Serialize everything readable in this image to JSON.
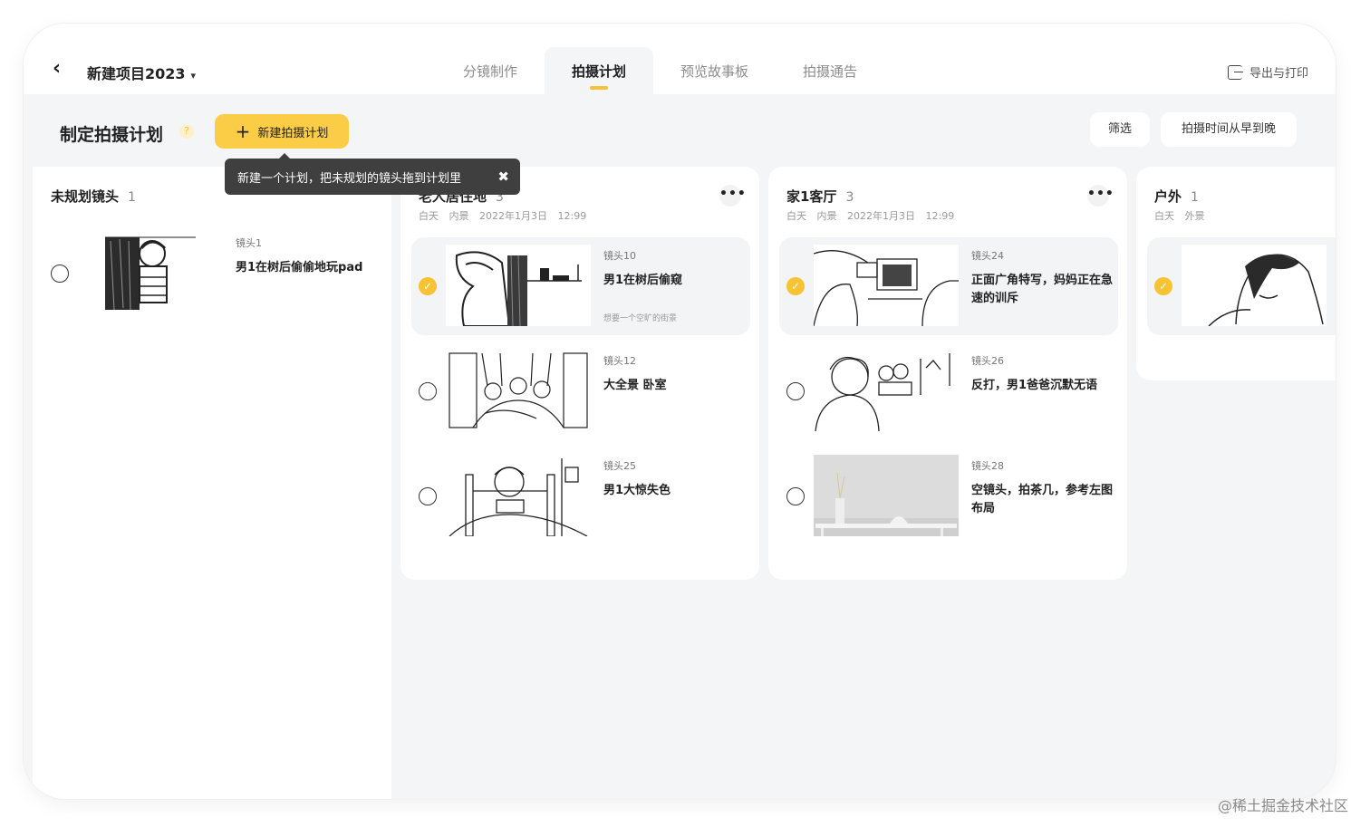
{
  "header": {
    "project_title": "新建项目2023",
    "tabs": [
      "分镜制作",
      "拍摄计划",
      "预览故事板",
      "拍摄通告"
    ],
    "active_tab": "拍摄计划",
    "export_label": "导出与打印"
  },
  "toolbar": {
    "title": "制定拍摄计划",
    "help_mark": "?",
    "new_plan_label": "新建拍摄计划",
    "tooltip": "新建一个计划，把未规划的镜头拖到计划里",
    "filter_label": "筛选",
    "sort_label": "拍摄时间从早到晚"
  },
  "unplanned": {
    "title": "未规划镜头",
    "count": "1",
    "shots": [
      {
        "id": "镜头1",
        "desc": "男1在树后偷偷地玩pad",
        "selected": false
      }
    ]
  },
  "columns": [
    {
      "title": "老人居住地",
      "count": "3",
      "time": "白天",
      "place": "内景",
      "date": "2022年1月3日 12:99",
      "more": "•••",
      "shots": [
        {
          "id": "镜头10",
          "desc": "男1在树后偷窥",
          "note": "想要一个空旷的街景",
          "selected": true
        },
        {
          "id": "镜头12",
          "desc": "大全景 卧室",
          "note": "",
          "selected": false
        },
        {
          "id": "镜头25",
          "desc": "男1大惊失色",
          "note": "",
          "selected": false
        }
      ]
    },
    {
      "title": "家1客厅",
      "count": "3",
      "time": "白天",
      "place": "内景",
      "date": "2022年1月3日 12:99",
      "more": "•••",
      "shots": [
        {
          "id": "镜头24",
          "desc": "正面广角特写，妈妈正在急速的训斥",
          "note": "",
          "selected": true
        },
        {
          "id": "镜头26",
          "desc": "反打，男1爸爸沉默无语",
          "note": "",
          "selected": false
        },
        {
          "id": "镜头28",
          "desc": "空镜头，拍茶几，参考左图布局",
          "note": "",
          "selected": false
        }
      ]
    },
    {
      "title": "户外",
      "count": "1",
      "time": "白天",
      "place": "外景",
      "date": "",
      "more": "",
      "shots": [
        {
          "id": "",
          "desc": "",
          "note": "",
          "selected": true
        }
      ]
    }
  ],
  "watermark": "@稀土掘金技术社区",
  "colors": {
    "accent": "#fbcc45",
    "check": "#f7c233",
    "background": "#f4f5f7"
  },
  "icons": {
    "back": "chevron-left-icon",
    "dropdown": "chevron-down-icon",
    "export": "export-icon",
    "plus": "plus-icon",
    "close": "close-icon",
    "check": "check-icon",
    "more": "more-icon"
  }
}
